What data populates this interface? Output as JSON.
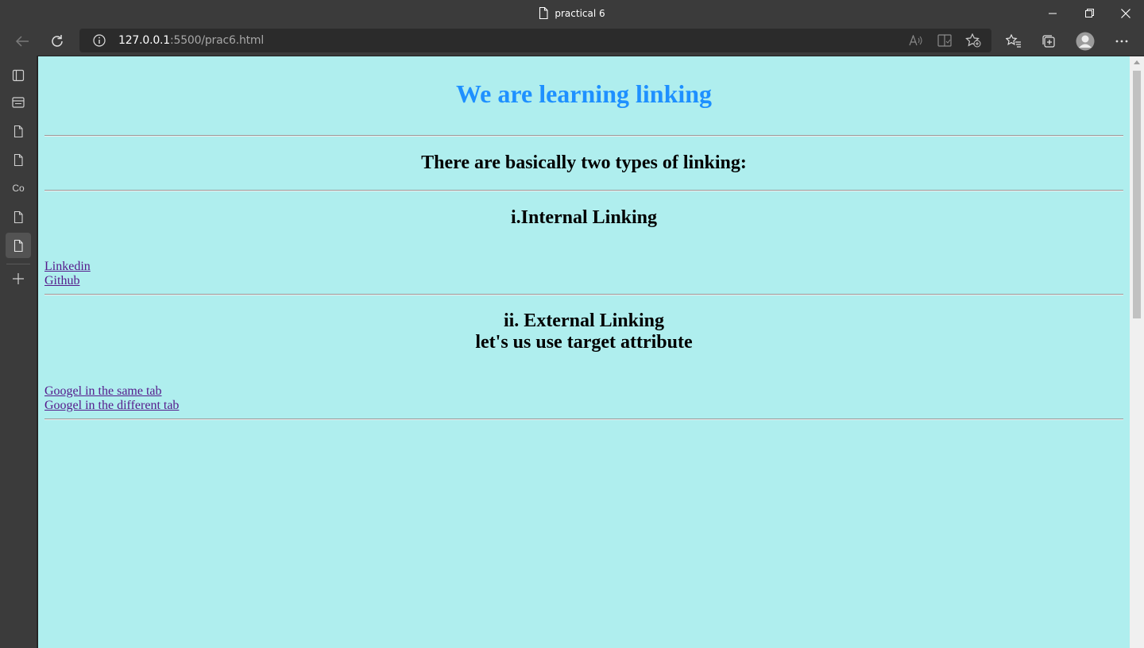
{
  "window": {
    "tab_title": "practical 6"
  },
  "toolbar": {
    "url_host": "127.0.0.1",
    "url_rest": ":5500/prac6.html"
  },
  "sidebar": {
    "items": [
      {
        "name": "tab-actions",
        "icon": "tab-actions-icon"
      },
      {
        "name": "tab",
        "icon": "window-icon"
      },
      {
        "name": "tab",
        "icon": "page-icon"
      },
      {
        "name": "tab",
        "icon": "page-icon"
      },
      {
        "name": "tab",
        "label": "Co"
      },
      {
        "name": "tab",
        "icon": "page-icon"
      },
      {
        "name": "tab-active",
        "icon": "page-icon"
      }
    ]
  },
  "page": {
    "background": "#afeeee",
    "title": "We are learning linking",
    "title_color": "#1e90ff",
    "intro": "There are basically two types of linking:",
    "internal_heading": "i.Internal Linking",
    "internal_links": [
      "Linkedin",
      "Github"
    ],
    "external_heading_line1": "ii. External Linking",
    "external_heading_line2": "let's us use target attribute",
    "external_links": [
      "Googel in the same tab",
      "Googel in the different tab"
    ]
  }
}
